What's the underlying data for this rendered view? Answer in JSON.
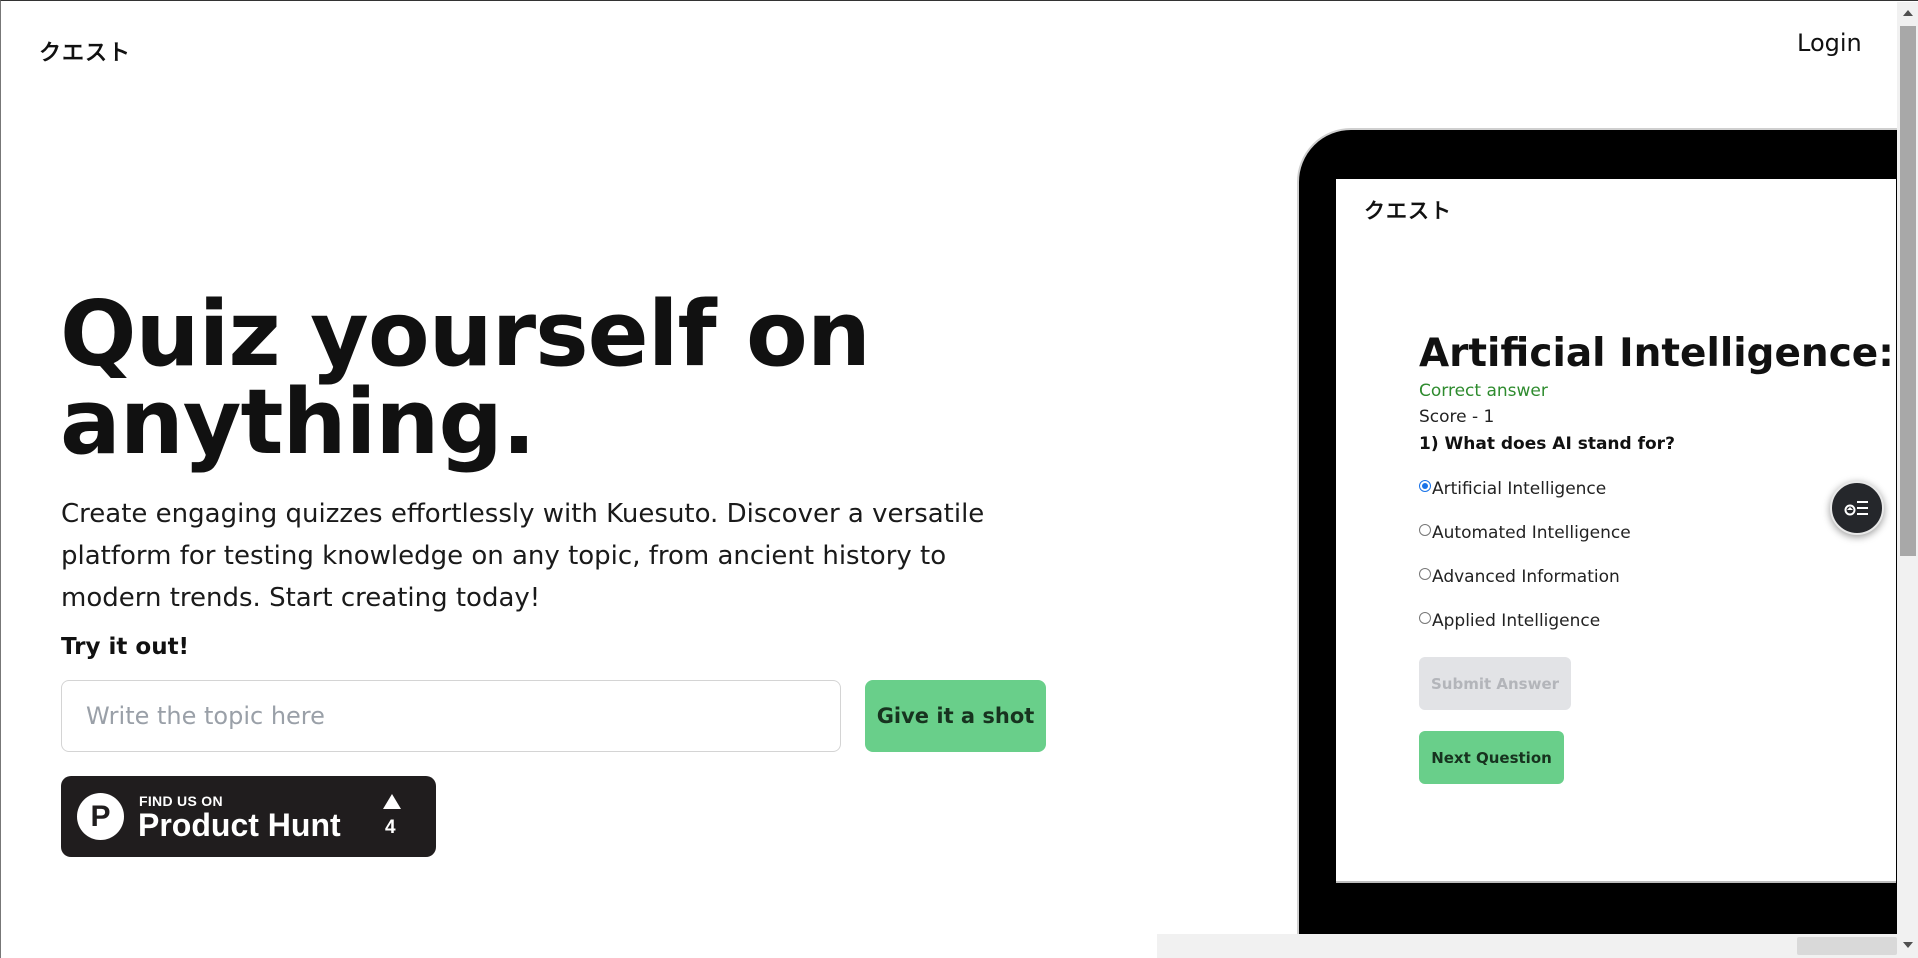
{
  "header": {
    "brand": "クエスト",
    "login_label": "Login"
  },
  "hero": {
    "title_line1": "Quiz yourself on",
    "title_line2": "anything.",
    "description": "Create engaging quizzes effortlessly with Kuesuto. Discover a versatile platform for testing knowledge on any topic, from ancient history to modern trends. Start creating today!",
    "try_label": "Try it out!",
    "topic_placeholder": "Write the topic here",
    "topic_value": "",
    "submit_label": "Give it a shot"
  },
  "product_hunt": {
    "small_text": "FIND US ON",
    "big_text": "Product Hunt",
    "logo_letter": "P",
    "upvotes": "4"
  },
  "preview": {
    "brand": "クエスト",
    "quiz_title": "Artificial Intelligence: A J",
    "feedback": "Correct answer",
    "score": "Score - 1",
    "question": "1) What does AI stand for?",
    "options": [
      {
        "label": "Artificial Intelligence",
        "checked": true
      },
      {
        "label": "Automated Intelligence",
        "checked": false
      },
      {
        "label": "Advanced Information",
        "checked": false
      },
      {
        "label": "Applied Intelligence",
        "checked": false
      }
    ],
    "submit_label": "Submit Answer",
    "next_label": "Next Question"
  },
  "floating_button": {
    "icon": "quiz-list-icon"
  },
  "colors": {
    "accent_green": "#69cf8a",
    "correct_green": "#2e8b2e",
    "laptop_frame": "#000000",
    "badge_bg": "#201d1e"
  }
}
